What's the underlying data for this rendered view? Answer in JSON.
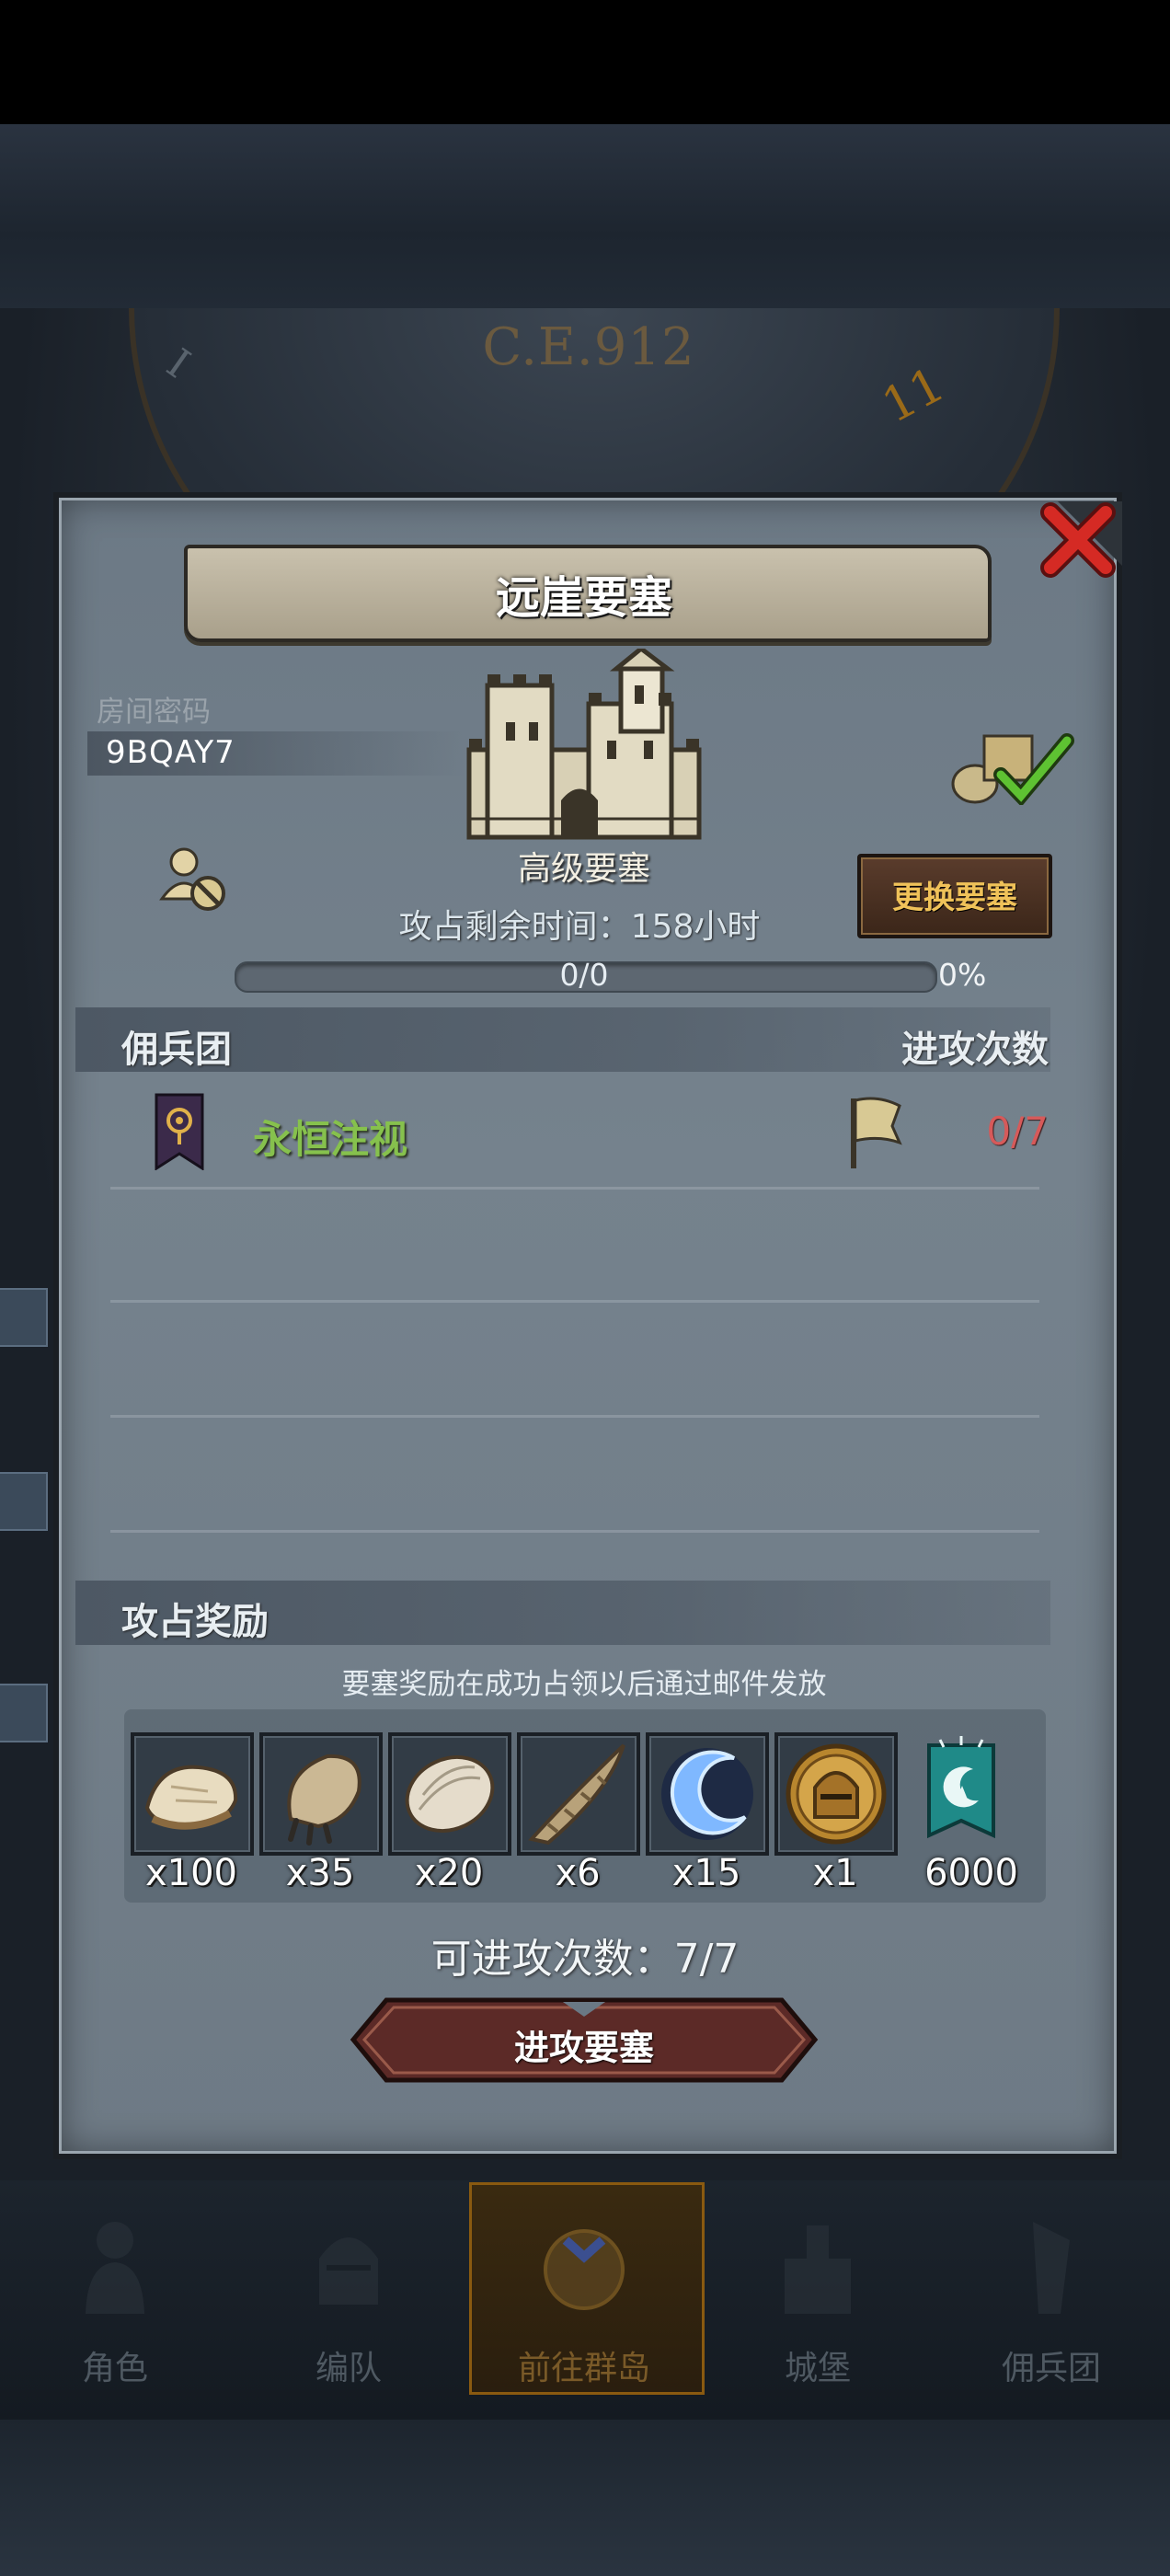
{
  "background": {
    "era": "C.E.912",
    "dial_numbers": [
      "11",
      "I"
    ]
  },
  "dialog": {
    "title": "远崖要塞",
    "room_label": "房间密码",
    "room_code": "9BQAY7",
    "fortress_type": "高级要塞",
    "change_button": "更换要塞",
    "time_label": "攻占剩余时间：158小时",
    "progress": {
      "count": "0/0",
      "percent_text": "0%",
      "fraction": 0
    },
    "merc_section": {
      "left_label": "佣兵团",
      "right_label": "进攻次数"
    },
    "guild": {
      "name": "永恒注视",
      "attacks": "0/7"
    },
    "reward_section": {
      "label": "攻占奖励",
      "note": "要塞奖励在成功占领以后通过邮件发放",
      "items": [
        {
          "icon": "fur-pelt-icon",
          "qty": "x100"
        },
        {
          "icon": "beast-claw-icon",
          "qty": "x35"
        },
        {
          "icon": "scale-hide-icon",
          "qty": "x20"
        },
        {
          "icon": "horn-icon",
          "qty": "x6"
        },
        {
          "icon": "blue-crescent-icon",
          "qty": "x15"
        },
        {
          "icon": "knight-helmet-coin-icon",
          "qty": "x1"
        },
        {
          "icon": "guild-banner-token-icon",
          "qty": "6000"
        }
      ]
    },
    "remaining_attacks": "可进攻次数：7/7",
    "attack_button": "进攻要塞"
  },
  "nav": [
    {
      "label": "角色",
      "icon": "knight-icon"
    },
    {
      "label": "编队",
      "icon": "helmet-icon"
    },
    {
      "label": "前往群岛",
      "icon": "islands-compass-icon"
    },
    {
      "label": "城堡",
      "icon": "castle-icon"
    },
    {
      "label": "佣兵团",
      "icon": "mercenary-icon"
    }
  ],
  "colors": {
    "guild_name": "#86c14d",
    "attack_count": "#d65a5a",
    "change_button_text": "#f0c259",
    "attack_button": "#6b2e2a"
  }
}
